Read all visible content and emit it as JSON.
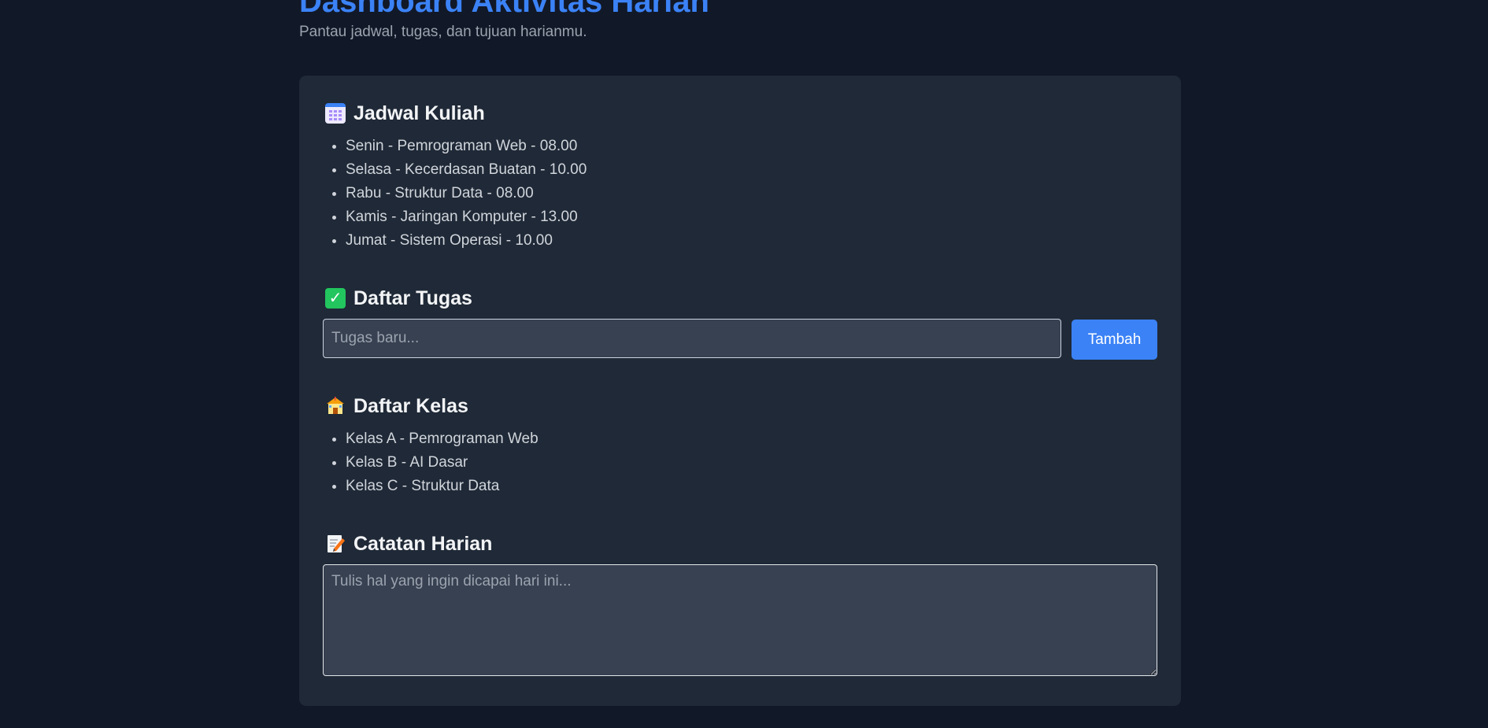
{
  "header": {
    "title": "Dashboard Aktivitas Harian",
    "subtitle": "Pantau jadwal, tugas, dan tujuan harianmu."
  },
  "schedule": {
    "icon": "calendar-icon",
    "title": "Jadwal Kuliah",
    "items": [
      "Senin - Pemrograman Web - 08.00",
      "Selasa - Kecerdasan Buatan - 10.00",
      "Rabu - Struktur Data - 08.00",
      "Kamis - Jaringan Komputer - 13.00",
      "Jumat - Sistem Operasi - 10.00"
    ]
  },
  "tasks": {
    "icon": "check-mark-icon",
    "title": "Daftar Tugas",
    "input_placeholder": "Tugas baru...",
    "input_value": "",
    "add_button_label": "Tambah"
  },
  "classes": {
    "icon": "school-icon",
    "title": "Daftar Kelas",
    "items": [
      "Kelas A - Pemrograman Web",
      "Kelas B - AI Dasar",
      "Kelas C - Struktur Data"
    ]
  },
  "notes": {
    "icon": "memo-icon",
    "title": "Catatan Harian",
    "placeholder": "Tulis hal yang ingin dicapai hari ini...",
    "value": ""
  },
  "colors": {
    "background": "#111827",
    "card": "#1f2937",
    "accent": "#3b82f6",
    "input_bg": "#374151"
  }
}
